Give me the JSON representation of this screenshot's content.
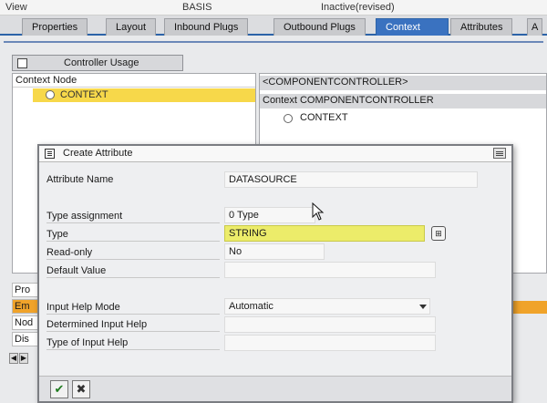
{
  "topbar": {
    "left": "View",
    "middle": "BASIS",
    "right": "Inactive(revised)"
  },
  "tabs": [
    {
      "label": "Properties",
      "active": false
    },
    {
      "label": "Layout",
      "active": false
    },
    {
      "label": "Inbound Plugs",
      "active": false
    },
    {
      "label": "Outbound Plugs",
      "active": false
    },
    {
      "label": "Context",
      "active": true
    },
    {
      "label": "Attributes",
      "active": false
    },
    {
      "label": "A",
      "active": false
    }
  ],
  "controller_usage": {
    "button_label": "Controller Usage",
    "left_header": "Context Node",
    "left_selected": "CONTEXT",
    "right_row1": "<COMPONENTCONTROLLER>",
    "right_row2": "Context COMPONENTCONTROLLER",
    "right_row3": "CONTEXT"
  },
  "lower_left": {
    "rows": [
      "Pro",
      "Em",
      "Nod",
      "Dis"
    ]
  },
  "dialog": {
    "title": "Create Attribute",
    "fields": {
      "attribute_name": {
        "label": "Attribute Name",
        "value": "DATASOURCE"
      },
      "type_assignment": {
        "label": "Type assignment",
        "value": "0 Type"
      },
      "type": {
        "label": "Type",
        "value": "STRING"
      },
      "read_only": {
        "label": "Read-only",
        "value": "No"
      },
      "default_value": {
        "label": "Default Value",
        "value": ""
      },
      "input_help_mode": {
        "label": "Input Help Mode",
        "value": "Automatic"
      },
      "determined_input_help": {
        "label": "Determined Input Help",
        "value": ""
      },
      "type_of_input_help": {
        "label": "Type of Input Help",
        "value": ""
      }
    },
    "buttons": {
      "ok": "✔",
      "cancel": "✖"
    }
  },
  "colors": {
    "selected": "#f7d84a",
    "yellow_field": "#ecec6a",
    "active_tab": "#3a72c0",
    "orange": "#f0a32a"
  }
}
